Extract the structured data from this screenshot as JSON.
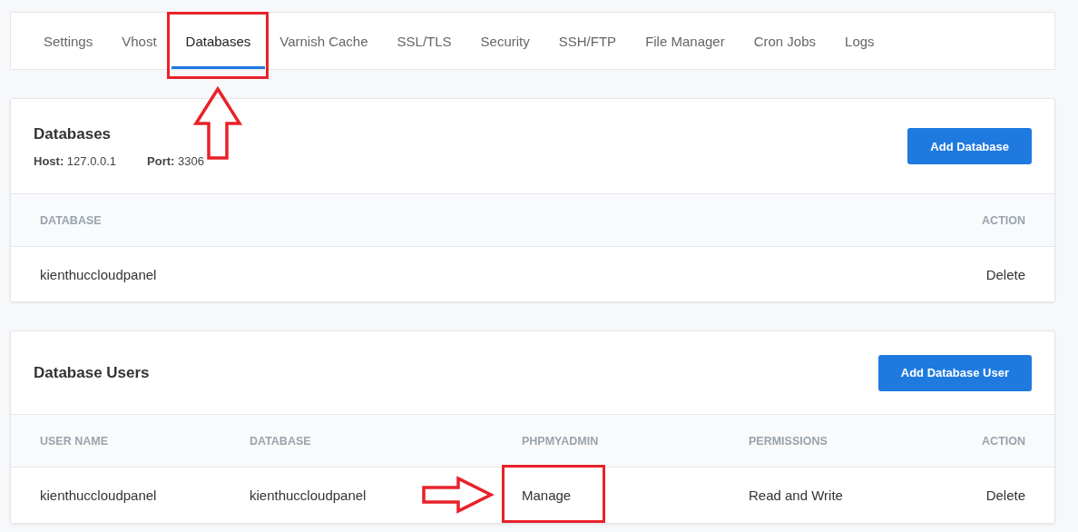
{
  "tabs": [
    {
      "label": "Settings",
      "selected": false
    },
    {
      "label": "Vhost",
      "selected": false
    },
    {
      "label": "Databases",
      "selected": true
    },
    {
      "label": "Varnish Cache",
      "selected": false
    },
    {
      "label": "SSL/TLS",
      "selected": false
    },
    {
      "label": "Security",
      "selected": false
    },
    {
      "label": "SSH/FTP",
      "selected": false
    },
    {
      "label": "File Manager",
      "selected": false
    },
    {
      "label": "Cron Jobs",
      "selected": false
    },
    {
      "label": "Logs",
      "selected": false
    }
  ],
  "databases": {
    "title": "Databases",
    "meta": [
      "**Host:** 127.0.0.1",
      "**Port:** 3306"
    ],
    "button": "Add Database",
    "columns": [
      "DATABASE",
      "ACTION"
    ],
    "rows": [
      [
        "kienthuccloudpanel",
        "Delete"
      ]
    ]
  },
  "database_users": {
    "title": "Database Users",
    "button": "Add Database User",
    "columns": [
      "USER NAME",
      "DATABASE",
      "PHPMYADMIN",
      "PERMISSIONS",
      "ACTION"
    ],
    "rows": [
      [
        "kienthuccloudpanel",
        "kienthuccloudpanel",
        "Manage",
        "Read and Write",
        "Delete"
      ]
    ]
  }
}
